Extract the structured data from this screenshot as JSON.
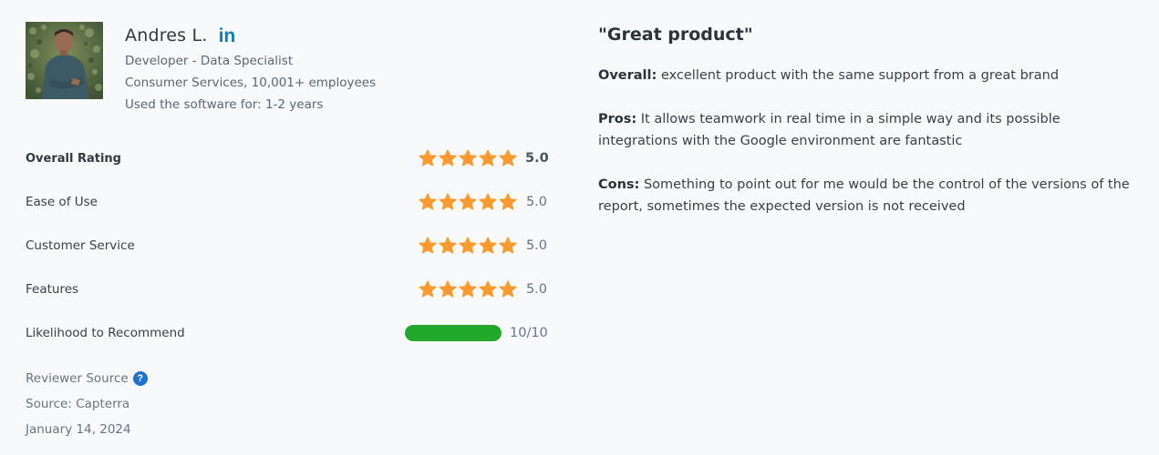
{
  "reviewer": {
    "name": "Andres L.",
    "linkedin_icon": "linkedin-icon",
    "linkedin_label": "in",
    "job_title": "Developer - Data Specialist",
    "company_info": "Consumer Services, 10,001+ employees",
    "usage_duration": "Used the software for: 1-2 years"
  },
  "ratings": {
    "items": [
      {
        "label": "Overall Rating",
        "score": "5.0",
        "stars": 5,
        "max_stars": 5,
        "bold": true
      },
      {
        "label": "Ease of Use",
        "score": "5.0",
        "stars": 5,
        "max_stars": 5,
        "bold": false
      },
      {
        "label": "Customer Service",
        "score": "5.0",
        "stars": 5,
        "max_stars": 5,
        "bold": false
      },
      {
        "label": "Features",
        "score": "5.0",
        "stars": 5,
        "max_stars": 5,
        "bold": false
      }
    ],
    "recommend": {
      "label": "Likelihood to Recommend",
      "score": "10/10",
      "value": 10,
      "max": 10
    }
  },
  "source": {
    "reviewer_source_label": "Reviewer Source",
    "help_icon": "question-circle-icon",
    "help_glyph": "?",
    "source_text": "Source: Capterra",
    "date": "January 14, 2024"
  },
  "review": {
    "title": "\"Great product\"",
    "overall_label": "Overall:",
    "overall_text": " excellent product with the same support from a great brand",
    "pros_label": "Pros:",
    "pros_text": " It allows teamwork in real time in a simple way and its possible integrations with the Google environment are fantastic",
    "cons_label": "Cons:",
    "cons_text": " Something to point out for me would be the control of the versions of the report, sometimes the expected version is not received"
  },
  "colors": {
    "star": "#fb9a2e",
    "recommend_bar": "#22a82a",
    "linkedin": "#0a7fc0",
    "help_icon": "#1f72c9",
    "background": "#f8f9fa"
  }
}
